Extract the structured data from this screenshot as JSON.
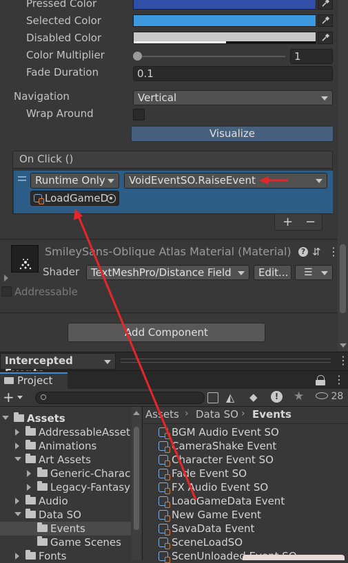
{
  "inspector": {
    "pressed_color_label": "Pressed Color",
    "selected_color_label": "Selected Color",
    "disabled_color_label": "Disabled Color",
    "color_multiplier_label": "Color Multiplier",
    "color_multiplier_value": "1",
    "color_multiplier_fraction": 0.0,
    "fade_duration_label": "Fade Duration",
    "fade_duration_value": "0.1",
    "navigation_label": "Navigation",
    "navigation_value": "Vertical",
    "wrap_around_label": "Wrap Around",
    "visualize_label": "Visualize",
    "colors": {
      "pressed": "#2f4fa8",
      "selected": "#3b9ae0",
      "disabled": "#c8c8c8"
    }
  },
  "onclick": {
    "header": "On Click ()",
    "runtime_value": "Runtime Only",
    "function_value": "VoidEventSO.RaiseEvent",
    "object_value": "LoadGameD",
    "add_label": "+",
    "remove_label": "−"
  },
  "material": {
    "title": "SmileySans-Oblique Atlas Material (Material)",
    "shader_label": "Shader",
    "shader_value": "TextMeshPro/Distance Field",
    "edit_label": "Edit...",
    "addressable_label": "Addressable"
  },
  "add_component_label": "Add Component",
  "intercepted_events": {
    "label": "Intercepted Events"
  },
  "project": {
    "tab_label": "Project",
    "hidden_count": "28",
    "breadcrumb": [
      "Assets",
      "Data SO",
      "Events"
    ],
    "tree": [
      {
        "label": "Assets",
        "bold": true
      },
      {
        "label": "AddressableAsset"
      },
      {
        "label": "Animations"
      },
      {
        "label": "Art Assets"
      },
      {
        "label": "Generic-Charac"
      },
      {
        "label": "Legacy-Fantasy"
      },
      {
        "label": "Audio"
      },
      {
        "label": "Data SO"
      },
      {
        "label": "Events"
      },
      {
        "label": "Game Scenes"
      },
      {
        "label": "Fonts"
      }
    ],
    "assets": [
      "BGM Audio Event SO",
      "CameraShake Event",
      "Character Event SO",
      "Fade Event SO",
      "FX Audio Event SO",
      "LoadGameData Event",
      "New Game Event",
      "SavaData Event",
      "SceneLoadSO",
      "ScenUnloaded Event SO"
    ]
  }
}
